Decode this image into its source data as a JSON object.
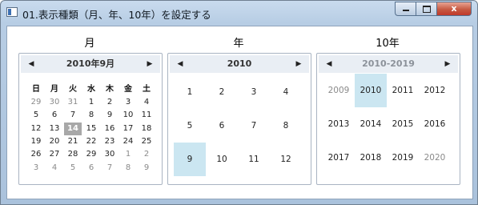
{
  "window": {
    "title": "01.表示種類（月、年、10年）を設定する",
    "min_label": "",
    "max_label": "",
    "close_label": "x"
  },
  "month_view": {
    "label": "月",
    "header": "2010年9月",
    "weekdays": [
      "日",
      "月",
      "火",
      "水",
      "木",
      "金",
      "土"
    ],
    "weeks": [
      [
        "29",
        "30",
        "31",
        "1",
        "2",
        "3",
        "4"
      ],
      [
        "5",
        "6",
        "7",
        "8",
        "9",
        "10",
        "11"
      ],
      [
        "12",
        "13",
        "14",
        "15",
        "16",
        "17",
        "18"
      ],
      [
        "19",
        "20",
        "21",
        "22",
        "23",
        "24",
        "25"
      ],
      [
        "26",
        "27",
        "28",
        "29",
        "30",
        "1",
        "2"
      ],
      [
        "3",
        "4",
        "5",
        "6",
        "7",
        "8",
        "9"
      ]
    ],
    "today": "14"
  },
  "year_view": {
    "label": "年",
    "header": "2010",
    "months": [
      "1",
      "2",
      "3",
      "4",
      "5",
      "6",
      "7",
      "8",
      "9",
      "10",
      "11",
      "12"
    ],
    "selected": "9"
  },
  "decade_view": {
    "label": "10年",
    "header": "2010-2019",
    "years": [
      "2009",
      "2010",
      "2011",
      "2012",
      "2013",
      "2014",
      "2015",
      "2016",
      "2017",
      "2018",
      "2019",
      "2020"
    ],
    "selected": "2010"
  },
  "colors": {
    "selected_background": "#cbe6f1",
    "today_background": "#a8a8a8",
    "header_background": "#e9eef4"
  }
}
